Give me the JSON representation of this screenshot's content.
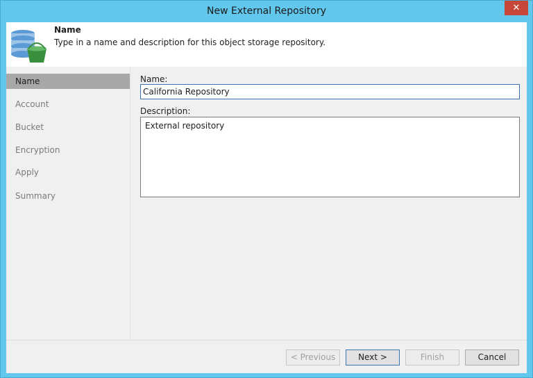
{
  "window": {
    "title": "New External Repository",
    "close_glyph": "✕"
  },
  "header": {
    "title": "Name",
    "description": "Type in a name and description for this object storage repository.",
    "icon": "object-storage-bucket-icon"
  },
  "steps": [
    {
      "label": "Name",
      "active": true
    },
    {
      "label": "Account",
      "active": false
    },
    {
      "label": "Bucket",
      "active": false
    },
    {
      "label": "Encryption",
      "active": false
    },
    {
      "label": "Apply",
      "active": false
    },
    {
      "label": "Summary",
      "active": false
    }
  ],
  "form": {
    "name_label": "Name:",
    "name_value": "California Repository",
    "description_label": "Description:",
    "description_value": "External repository"
  },
  "buttons": {
    "previous": "< Previous",
    "next": "Next >",
    "finish": "Finish",
    "cancel": "Cancel"
  },
  "colors": {
    "frame": "#62c7ec",
    "close": "#c7463a",
    "active_step": "#a8a8a8",
    "focus_border": "#3b74b5"
  }
}
